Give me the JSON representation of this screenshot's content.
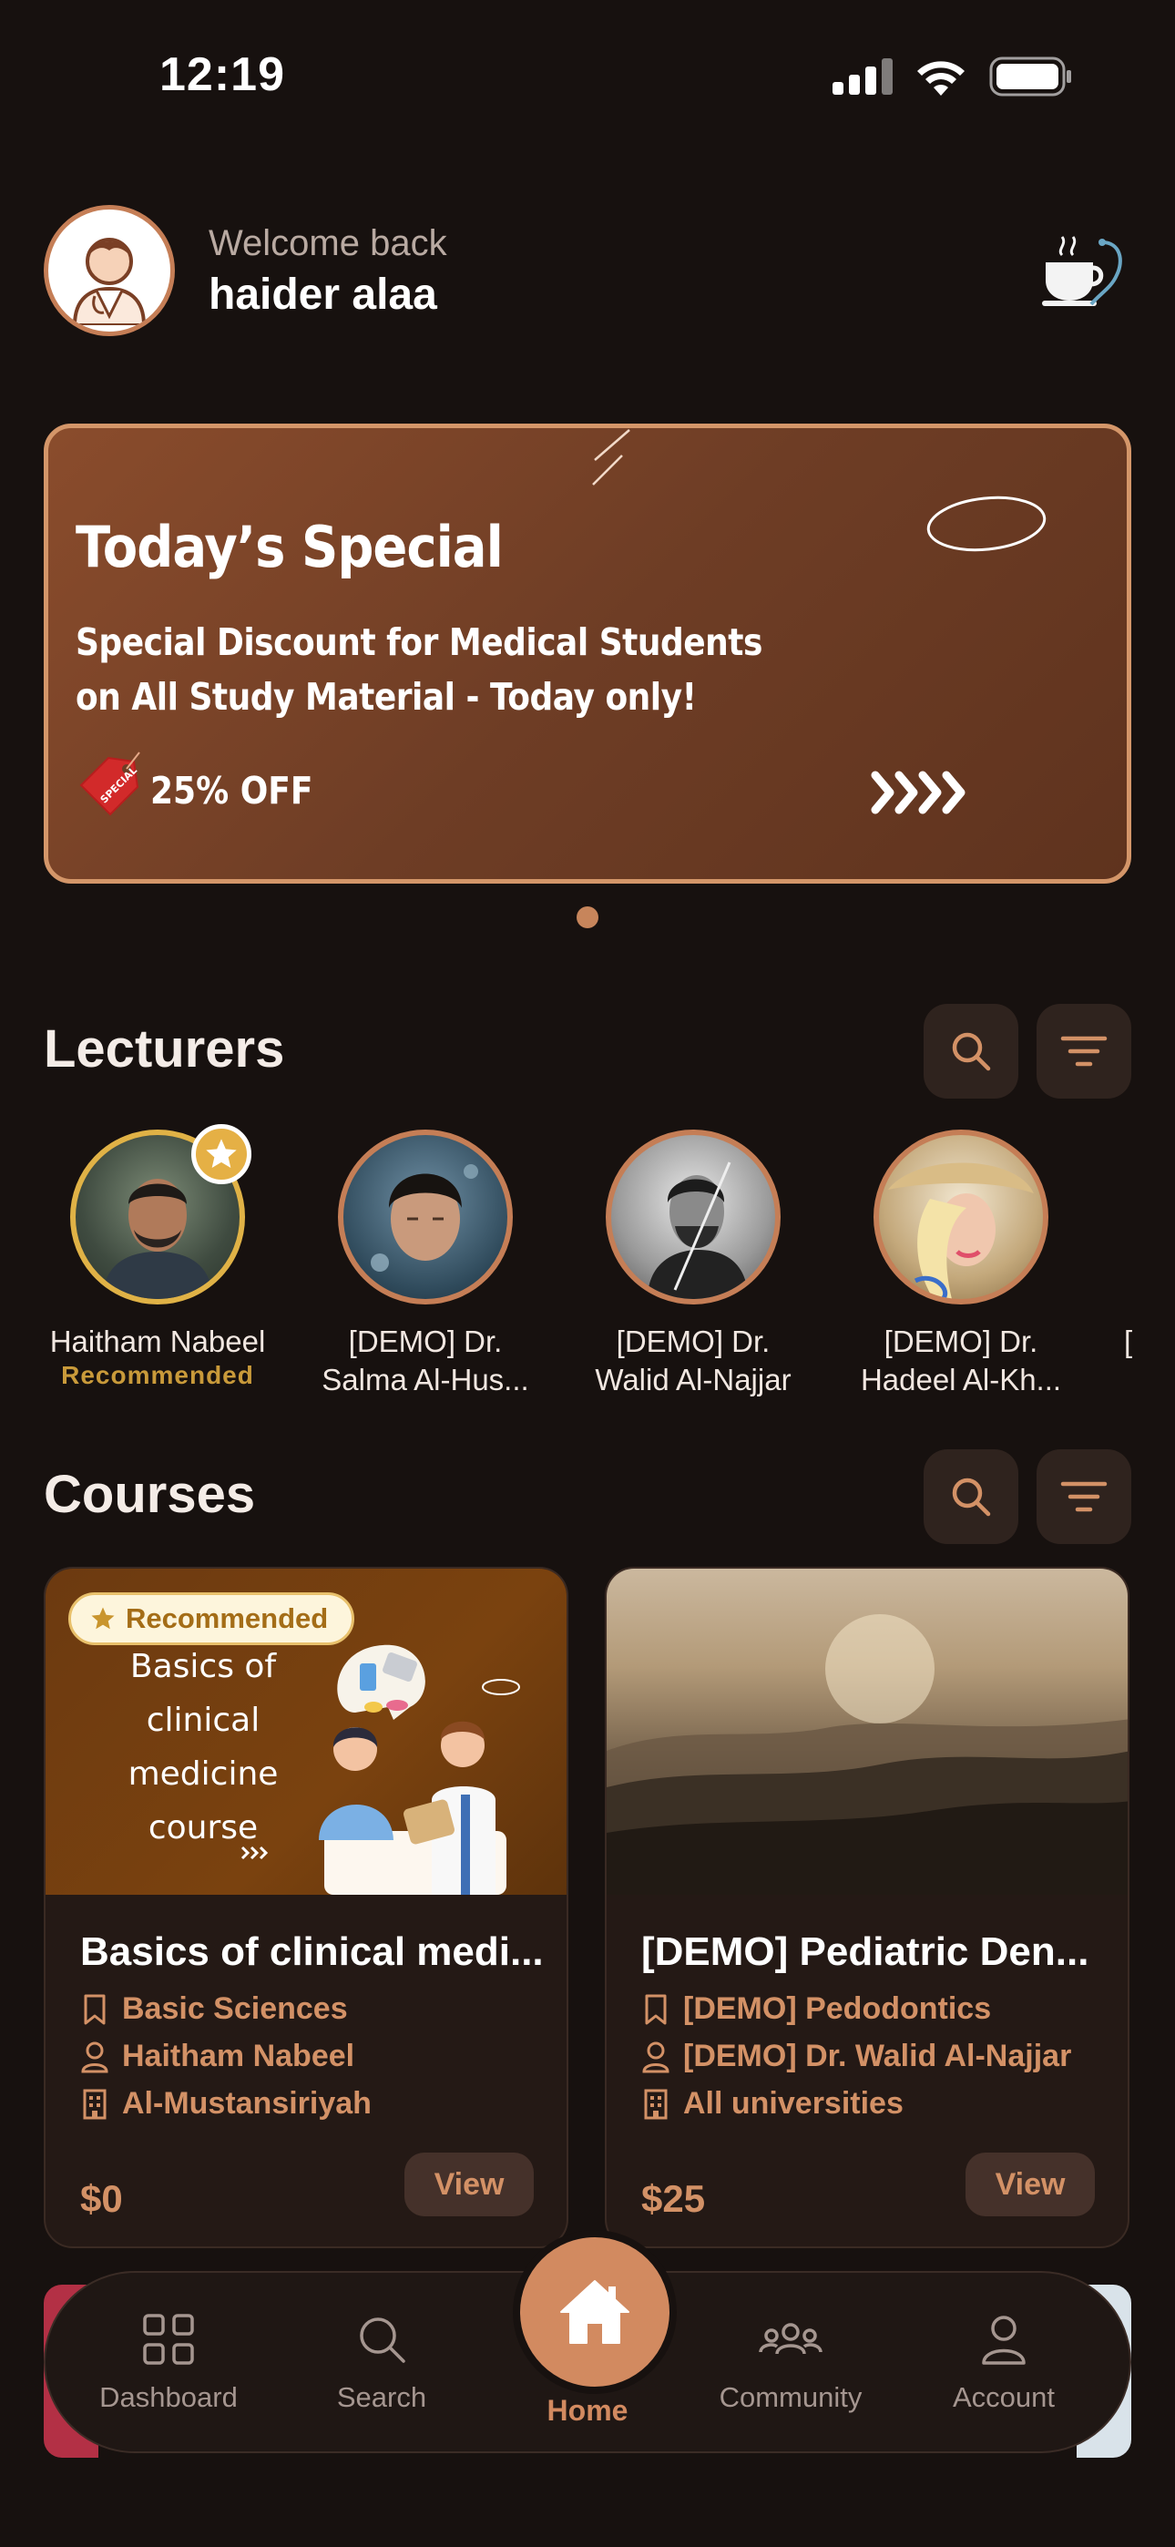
{
  "status_bar": {
    "time": "12:19"
  },
  "header": {
    "welcome": "Welcome back",
    "username": "haider alaa"
  },
  "banner": {
    "title": "Today’s Special",
    "line1": "Special Discount for Medical Students",
    "line2": "on All Study Material - Today only!",
    "offer": "25% OFF",
    "tag_text": "SPECIAL",
    "arrows": "»»»»"
  },
  "lecturers": {
    "title": "Lecturers",
    "items": [
      {
        "name": "Haitham Nabeel",
        "subtitle": "Recommended"
      },
      {
        "name": "[DEMO] Dr.",
        "subtitle": "Salma Al-Hus..."
      },
      {
        "name": "[DEMO] Dr.",
        "subtitle": "Walid Al-Najjar"
      },
      {
        "name": "[DEMO] Dr.",
        "subtitle": "Hadeel Al-Kh..."
      },
      {
        "name": "[",
        "subtitle": "["
      }
    ]
  },
  "courses": {
    "title": "Courses",
    "items": [
      {
        "badge": "Recommended",
        "image_text": [
          "Basics of",
          "clinical",
          "medicine",
          "course"
        ],
        "title": "Basics of clinical medi...",
        "category": "Basic Sciences",
        "lecturer": "Haitham Nabeel",
        "university": "Al-Mustansiriyah",
        "price": "$0",
        "action": "View"
      },
      {
        "title": "[DEMO] Pediatric Den...",
        "category": "[DEMO] Pedodontics",
        "lecturer": "[DEMO] Dr. Walid Al-Najjar",
        "university": "All universities",
        "price": "$25",
        "action": "View"
      }
    ]
  },
  "nav": {
    "items": [
      {
        "label": "Dashboard",
        "icon": "grid-icon"
      },
      {
        "label": "Search",
        "icon": "search-icon"
      },
      {
        "label": "Home",
        "icon": "home-icon",
        "active": true
      },
      {
        "label": "Community",
        "icon": "people-icon"
      },
      {
        "label": "Account",
        "icon": "user-icon"
      }
    ]
  },
  "colors": {
    "accent": "#d28a60",
    "background": "#17110f",
    "banner": "#6e3d25",
    "recommended": "#c99a3a"
  }
}
